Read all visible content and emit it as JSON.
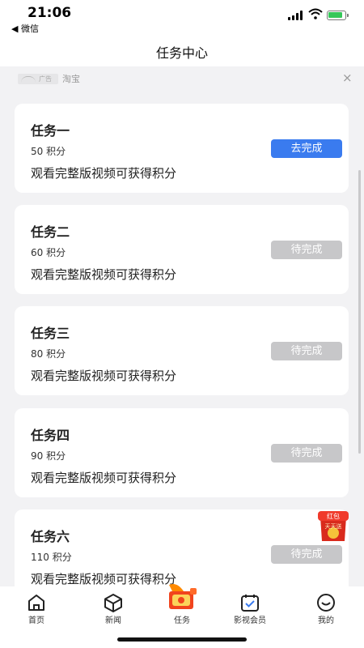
{
  "status_bar": {
    "time": "21:06",
    "back_app": "◀ 微信"
  },
  "nav": {
    "title": "任务中心"
  },
  "ad": {
    "logo_label": "广告",
    "text": "淘宝",
    "close": "×"
  },
  "tasks": [
    {
      "title": "任务一",
      "points": "50 积分",
      "desc": "观看完整版视频可获得积分",
      "button": "去完成",
      "state": "active"
    },
    {
      "title": "任务二",
      "points": "60 积分",
      "desc": "观看完整版视频可获得积分",
      "button": "待完成",
      "state": "pending"
    },
    {
      "title": "任务三",
      "points": "80 积分",
      "desc": "观看完整版视频可获得积分",
      "button": "待完成",
      "state": "pending"
    },
    {
      "title": "任务四",
      "points": "90 积分",
      "desc": "观看完整版视频可获得积分",
      "button": "待完成",
      "state": "pending"
    },
    {
      "title": "任务六",
      "points": "110 积分",
      "desc": "观看完整版视频可获得积分",
      "button": "待完成",
      "state": "pending"
    }
  ],
  "red_packet_badge": {
    "line1": "红包",
    "line2": "天天送"
  },
  "tab_bar": {
    "items": [
      {
        "label": "首页",
        "icon": "home-icon"
      },
      {
        "label": "新闻",
        "icon": "news-icon"
      },
      {
        "label": "任务",
        "icon": "gift-box-icon"
      },
      {
        "label": "影视会员",
        "icon": "vip-icon"
      },
      {
        "label": "我的",
        "icon": "profile-icon"
      }
    ]
  },
  "colors": {
    "accent": "#3a7bef",
    "pending": "#c7c7c9",
    "background": "#f2f2f4"
  }
}
